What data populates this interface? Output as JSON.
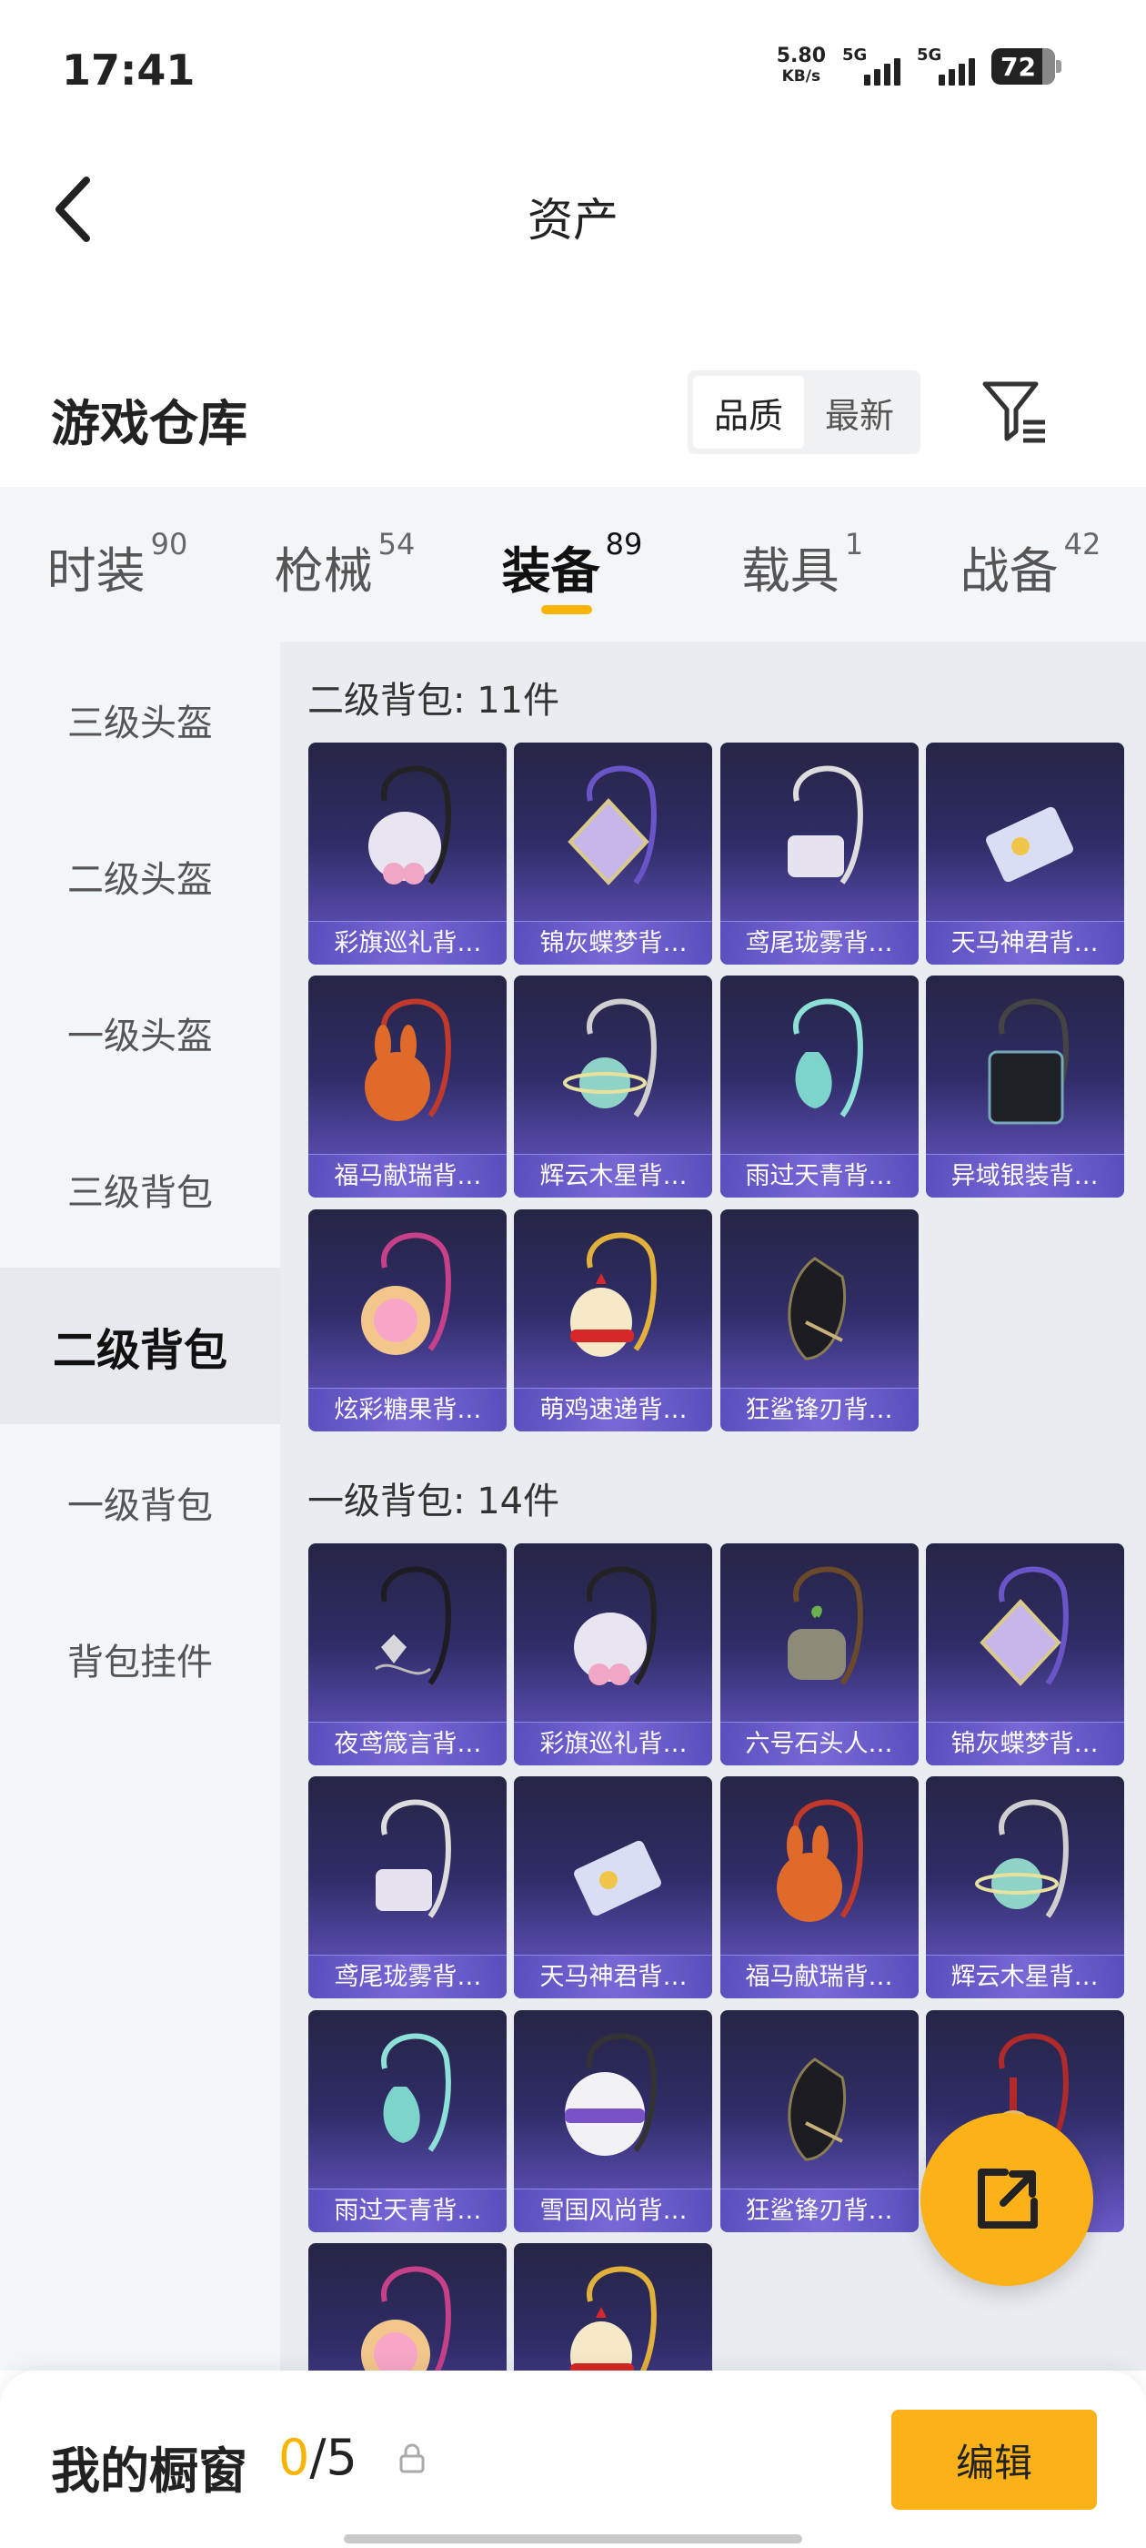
{
  "status": {
    "time": "17:41",
    "speed": "5.80",
    "speed_unit": "KB/s",
    "net1": "5G",
    "net2": "5G",
    "battery": "72"
  },
  "header": {
    "title": "资产"
  },
  "warehouse": {
    "title": "游戏仓库",
    "sort_options": [
      "品质",
      "最新"
    ],
    "active_sort": 0
  },
  "tabs": [
    {
      "label": "时装",
      "count": "90"
    },
    {
      "label": "枪械",
      "count": "54"
    },
    {
      "label": "装备",
      "count": "89"
    },
    {
      "label": "载具",
      "count": "1"
    },
    {
      "label": "战备",
      "count": "42"
    }
  ],
  "active_tab": 2,
  "sidebar": [
    "三级头盔",
    "二级头盔",
    "一级头盔",
    "三级背包",
    "二级背包",
    "一级背包",
    "背包挂件"
  ],
  "active_sidebar": 4,
  "sections": [
    {
      "title": "二级背包: 11件",
      "items": [
        {
          "name": "彩旗巡礼背…",
          "icon": "round-white-backpack"
        },
        {
          "name": "锦灰蝶梦背…",
          "icon": "diamond-purple-backpack"
        },
        {
          "name": "鸢尾珑雾背…",
          "icon": "white-pouch-backpack"
        },
        {
          "name": "天马神君背…",
          "icon": "scroll-backpack"
        },
        {
          "name": "福马献瑞背…",
          "icon": "orange-bunny-backpack"
        },
        {
          "name": "辉云木星背…",
          "icon": "planet-backpack"
        },
        {
          "name": "雨过天青背…",
          "icon": "teal-flask-backpack"
        },
        {
          "name": "异域银装背…",
          "icon": "black-tech-backpack"
        },
        {
          "name": "炫彩糖果背…",
          "icon": "donut-backpack"
        },
        {
          "name": "萌鸡速递背…",
          "icon": "chick-backpack"
        },
        {
          "name": "狂鲨锋刃背…",
          "icon": "shark-backpack"
        }
      ]
    },
    {
      "title": "一级背包: 14件",
      "items": [
        {
          "name": "夜鸢箴言背…",
          "icon": "white-pendant-backpack"
        },
        {
          "name": "彩旗巡礼背…",
          "icon": "round-white-backpack"
        },
        {
          "name": "六号石头人…",
          "icon": "stone-golem-backpack"
        },
        {
          "name": "锦灰蝶梦背…",
          "icon": "diamond-purple-backpack"
        },
        {
          "name": "鸢尾珑雾背…",
          "icon": "white-pouch-backpack"
        },
        {
          "name": "天马神君背…",
          "icon": "scroll-backpack"
        },
        {
          "name": "福马献瑞背…",
          "icon": "orange-bunny-backpack"
        },
        {
          "name": "辉云木星背…",
          "icon": "planet-backpack"
        },
        {
          "name": "雨过天青背…",
          "icon": "teal-flask-backpack"
        },
        {
          "name": "雪国风尚背…",
          "icon": "snowman-backpack"
        },
        {
          "name": "狂鲨锋刃背…",
          "icon": "shark-backpack"
        },
        {
          "name": "",
          "icon": "red-tassel-backpack"
        },
        {
          "name": "",
          "icon": "donut-backpack"
        },
        {
          "name": "",
          "icon": "chick-backpack"
        }
      ]
    }
  ],
  "bottom": {
    "title": "我的橱窗",
    "current": "0",
    "total": "/5",
    "edit_label": "编辑"
  },
  "colors": {
    "accent": "#fbb218",
    "card_top": "#262545",
    "card_bottom": "#6b5bc9"
  }
}
